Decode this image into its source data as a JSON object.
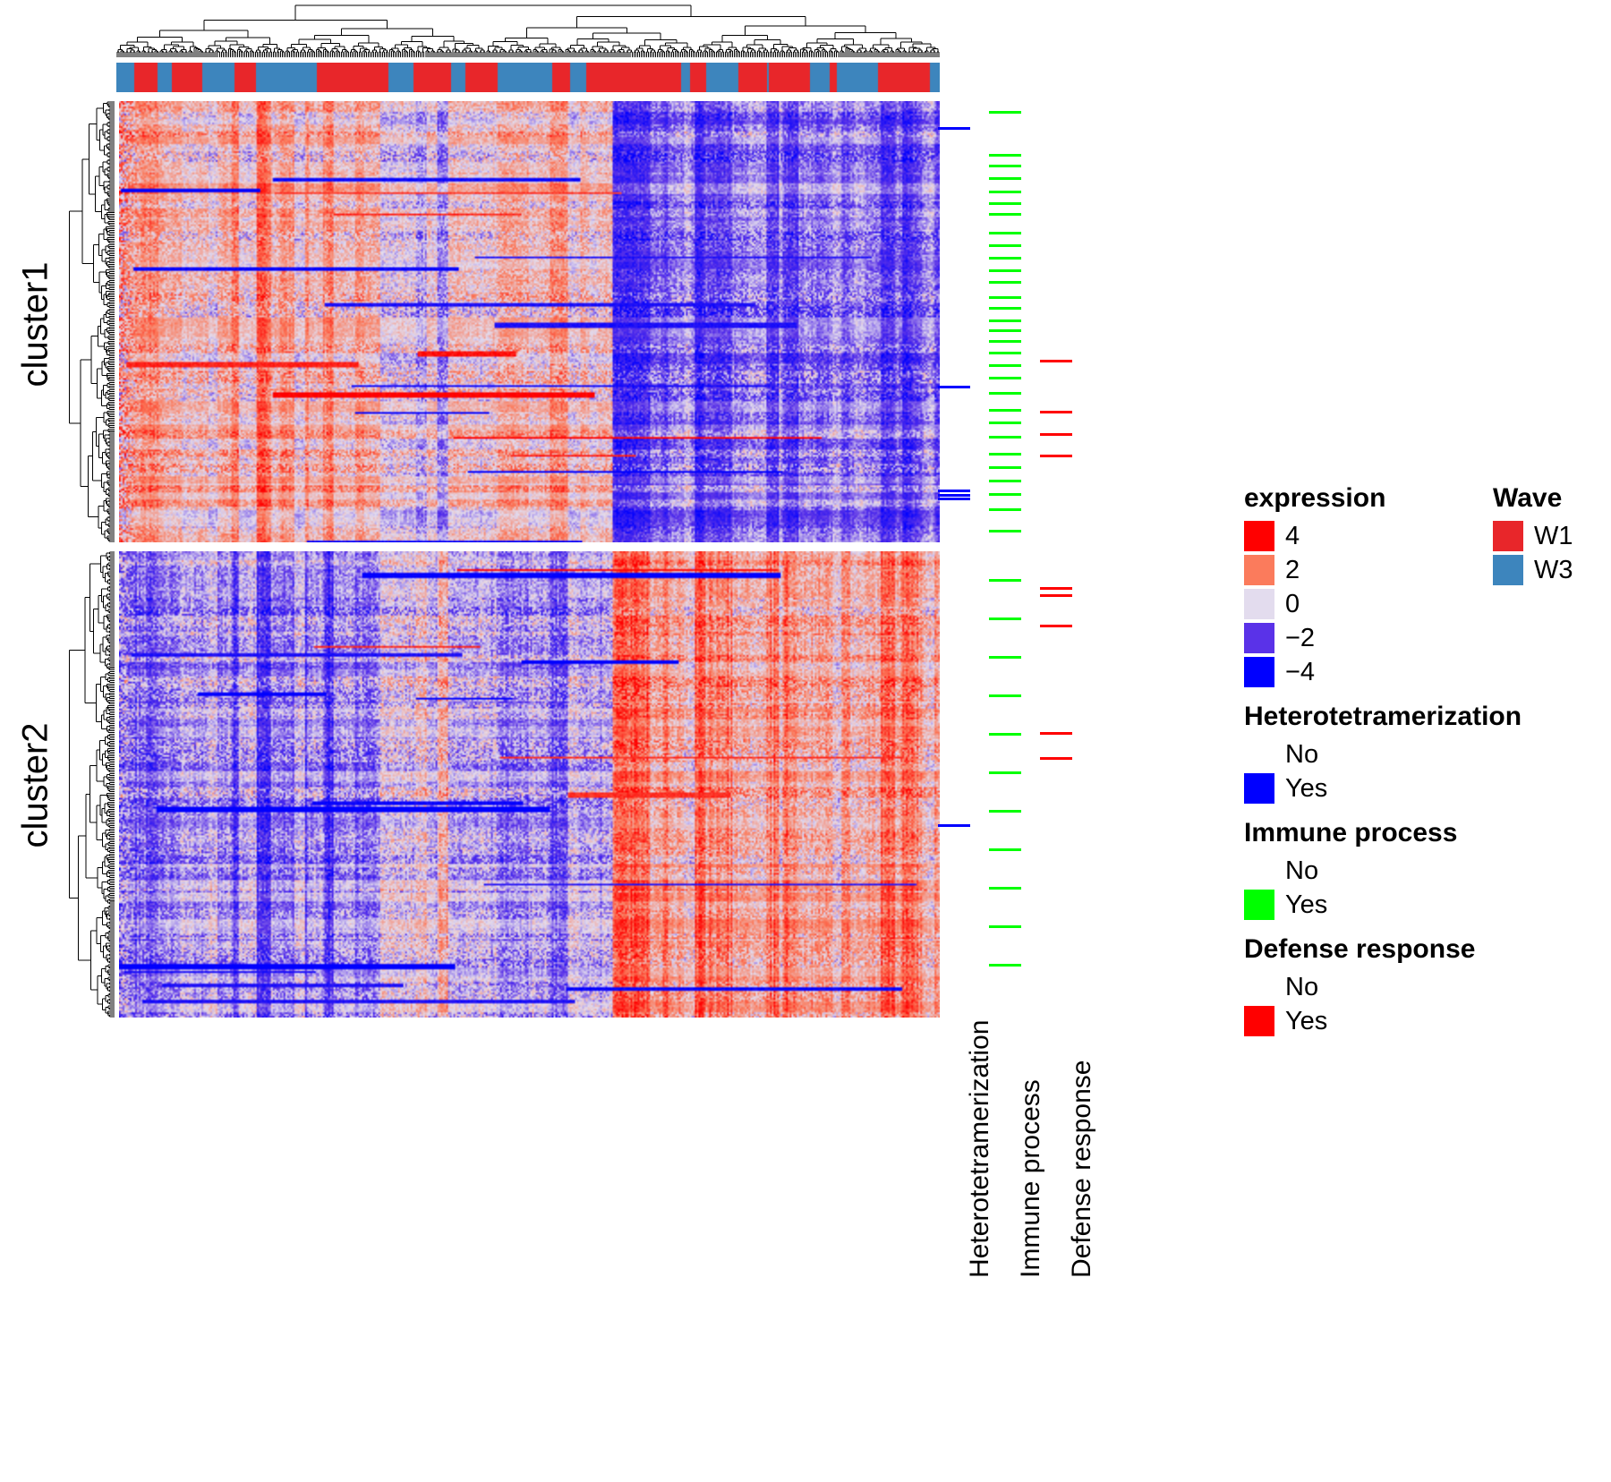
{
  "figure": {
    "type": "heatmap",
    "row_clusters": [
      {
        "id": "cluster1",
        "label": "cluster1",
        "n_rows": 247
      },
      {
        "id": "cluster2",
        "label": "cluster2",
        "n_rows": 261
      }
    ],
    "n_columns": 459
  },
  "row_annotation_titles": {
    "heterotetramerization": "Heterotetramerization",
    "immune_process": "Immune process",
    "defense_response": "Defense response"
  },
  "legends": {
    "expression": {
      "title": "expression",
      "items": [
        {
          "label": "4",
          "color": "#FF0000"
        },
        {
          "label": "2",
          "color": "#FB7B5C"
        },
        {
          "label": "0",
          "color": "#E3DCEE"
        },
        {
          "label": "−2",
          "color": "#5A32E8"
        },
        {
          "label": "−4",
          "color": "#0000FF"
        }
      ]
    },
    "heterotetramerization": {
      "title": "Heterotetramerization",
      "items": [
        {
          "label": "No",
          "color": "transparent"
        },
        {
          "label": "Yes",
          "color": "#0000FF"
        }
      ]
    },
    "immune_process": {
      "title": "Immune process",
      "items": [
        {
          "label": "No",
          "color": "transparent"
        },
        {
          "label": "Yes",
          "color": "#00FF00"
        }
      ]
    },
    "defense_response": {
      "title": "Defense response",
      "items": [
        {
          "label": "No",
          "color": "transparent"
        },
        {
          "label": "Yes",
          "color": "#FF0000"
        }
      ]
    },
    "wave": {
      "title": "Wave",
      "items": [
        {
          "label": "W1",
          "color": "#E8262A"
        },
        {
          "label": "W3",
          "color": "#3D85BD"
        }
      ]
    }
  },
  "chart_data": {
    "type": "heatmap",
    "title": "",
    "xlabel": "",
    "ylabel": "",
    "colorbar": {
      "name": "expression",
      "ticks": [
        4,
        2,
        0,
        -2,
        -4
      ],
      "colors": [
        "#FF0000",
        "#FB7B5C",
        "#E3DCEE",
        "#5A32E8",
        "#0000FF"
      ],
      "vmin": -4,
      "vmax": 4
    },
    "row_split": [
      "cluster1",
      "cluster2"
    ],
    "row_dendrogram": true,
    "column_dendrogram": true,
    "column_annotation": {
      "name": "Wave",
      "categories": [
        "W1",
        "W3"
      ],
      "colors": {
        "W1": "#E8262A",
        "W3": "#3D85BD"
      }
    },
    "row_annotations": [
      {
        "name": "Heterotetramerization",
        "yes_color": "#0000FF",
        "no_color": "#FFFFFF"
      },
      {
        "name": "Immune process",
        "yes_color": "#00FF00",
        "no_color": "#FFFFFF"
      },
      {
        "name": "Defense response",
        "yes_color": "#FF0000",
        "no_color": "#FFFFFF"
      }
    ],
    "row_annotation_marks": {
      "Heterotetramerization": [
        0.062,
        0.648,
        0.884,
        0.894,
        0.902,
        1.588
      ],
      "Immune process": [
        0.025,
        0.122,
        0.148,
        0.176,
        0.205,
        0.232,
        0.257,
        0.3,
        0.327,
        0.355,
        0.385,
        0.41,
        0.445,
        0.47,
        0.497,
        0.52,
        0.545,
        0.57,
        0.6,
        0.628,
        0.662,
        0.7,
        0.73,
        0.762,
        0.8,
        0.83,
        0.862,
        0.892,
        0.925,
        0.975,
        1.062,
        1.145,
        1.228,
        1.31,
        1.392,
        1.475,
        1.558,
        1.64,
        1.722,
        1.805,
        1.888
      ],
      "Defense response": [
        0.59,
        0.705,
        0.755,
        0.805,
        1.08,
        1.095,
        1.16,
        1.39,
        1.445
      ]
    }
  }
}
